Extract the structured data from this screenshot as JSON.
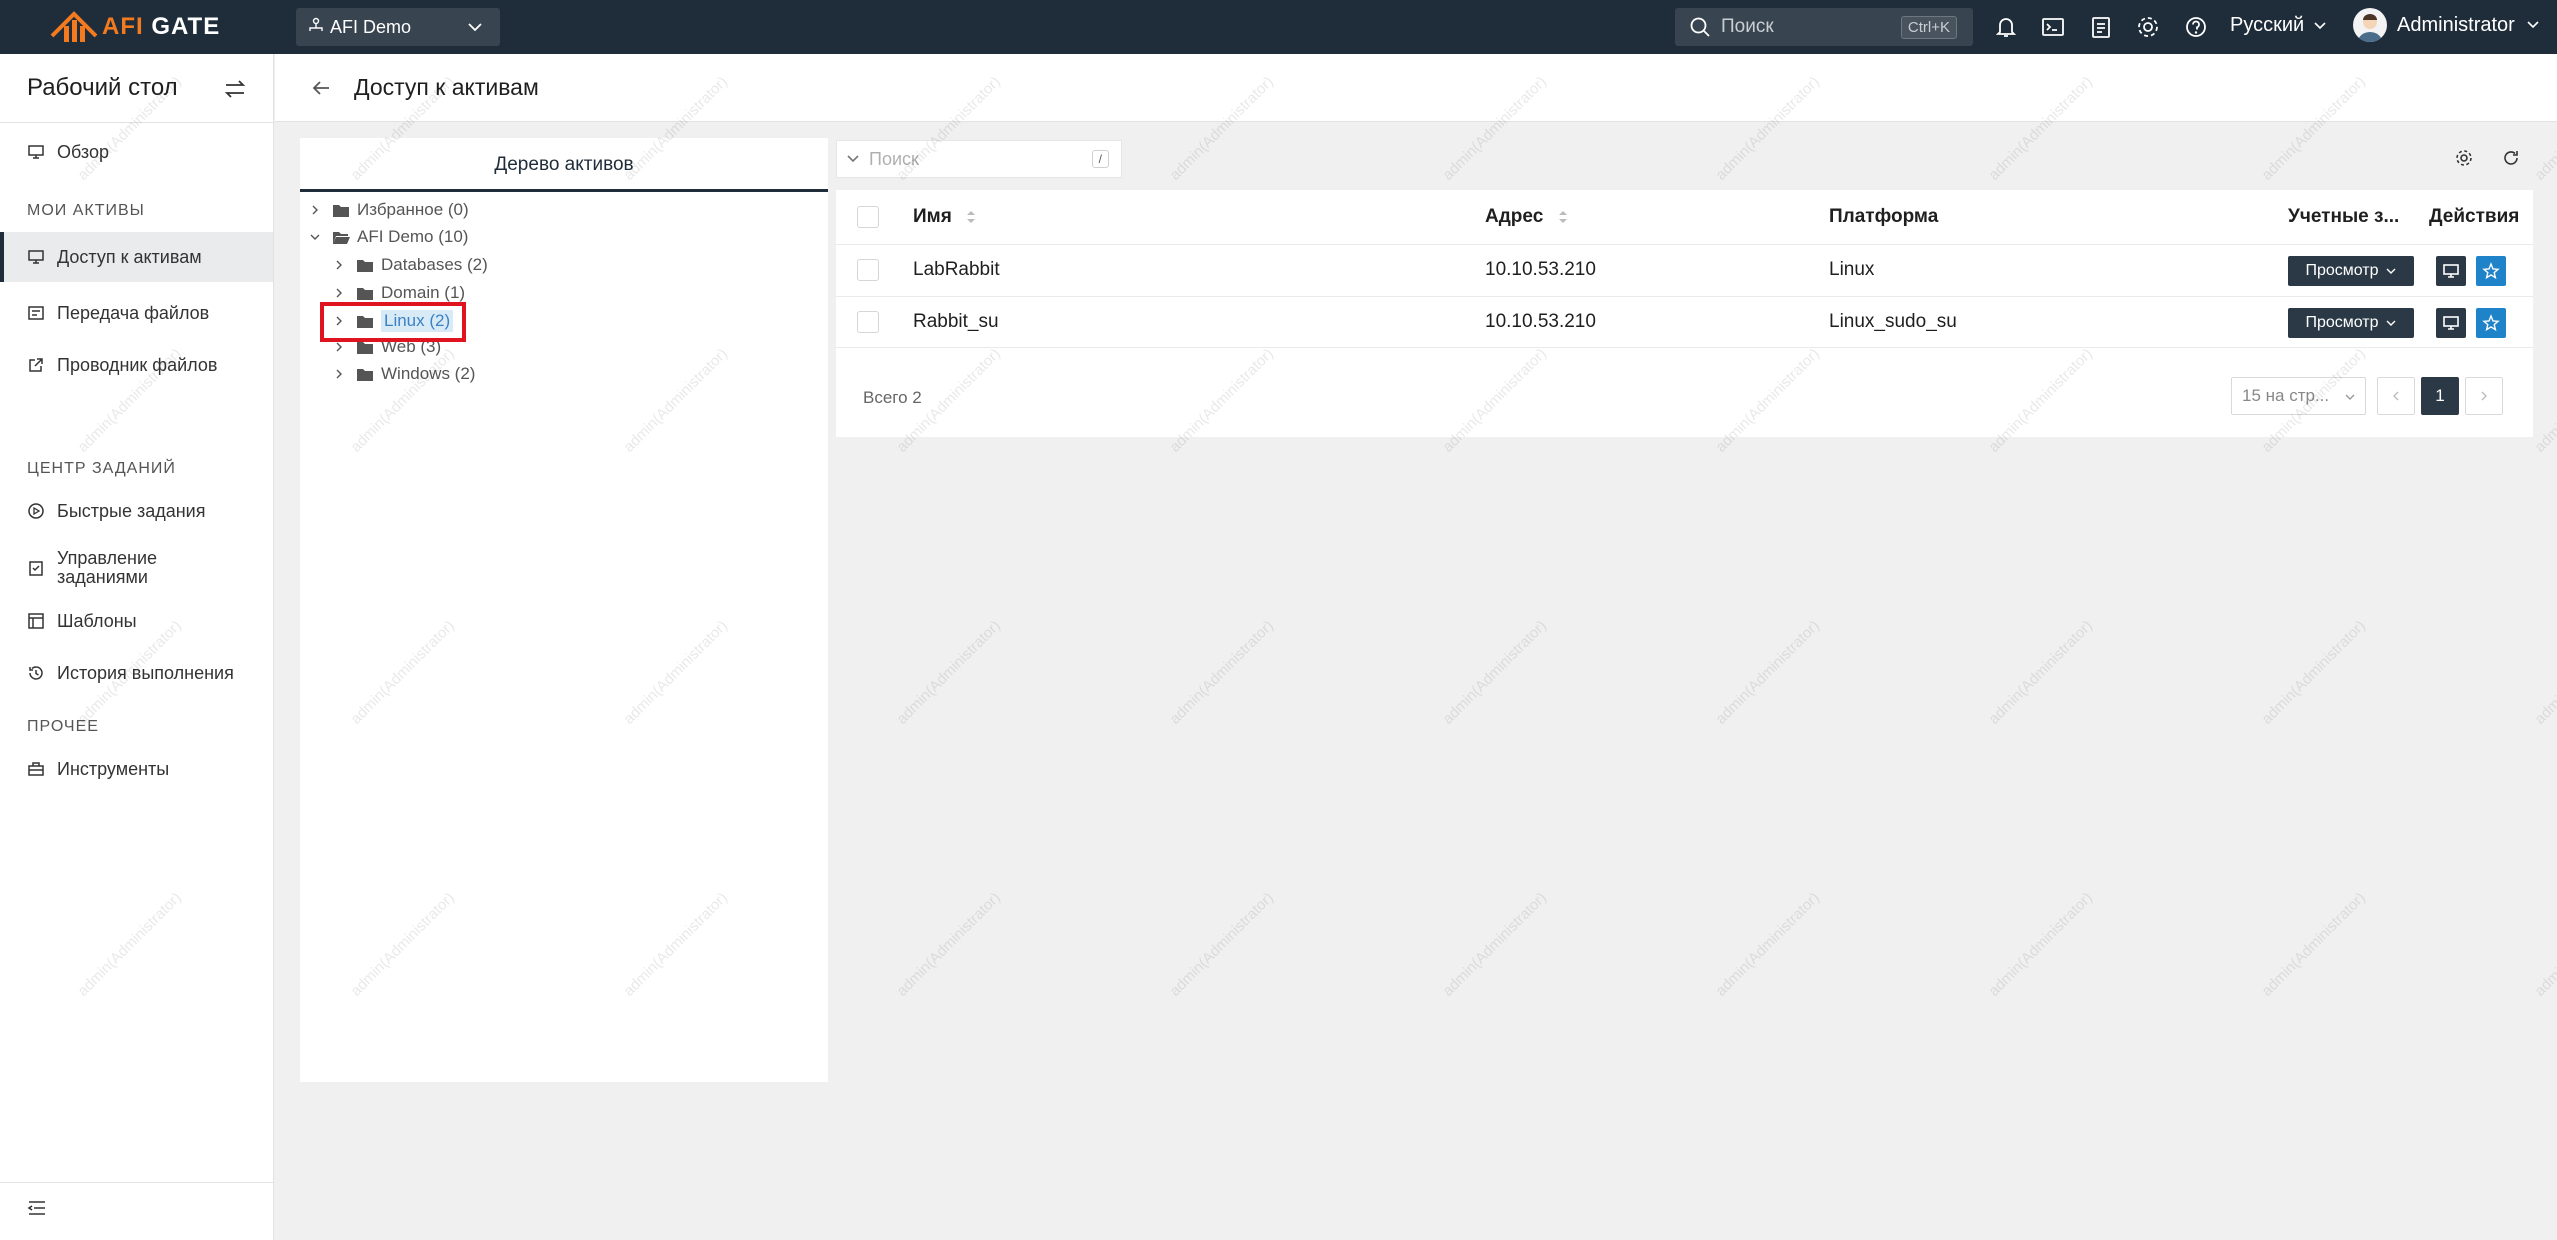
{
  "header": {
    "logo_text": "AFI GATE",
    "logo_text_accent": "AFI",
    "logo_text_rest": " GATE",
    "org": "AFI Demo",
    "search_placeholder": "Поиск",
    "search_shortcut": "Ctrl+K",
    "language": "Русский",
    "user": "Administrator"
  },
  "sidebar": {
    "title": "Рабочий стол",
    "overview": "Обзор",
    "group_my_assets": "МОИ АКТИВЫ",
    "asset_access": "Доступ к активам",
    "file_transfer": "Передача файлов",
    "file_explorer": "Проводник файлов",
    "group_tasks": "ЦЕНТР ЗАДАНИЙ",
    "quick_tasks": "Быстрые задания",
    "task_mgmt_1": "Управление",
    "task_mgmt_2": "заданиями",
    "templates": "Шаблоны",
    "history": "История выполнения",
    "group_other": "ПРОЧЕЕ",
    "tools": "Инструменты"
  },
  "page": {
    "title": "Доступ к активам"
  },
  "tree": {
    "tab": "Дерево активов",
    "nodes": [
      {
        "label": "Избранное (0)"
      },
      {
        "label": "AFI Demo (10)"
      },
      {
        "label": "Databases (2)"
      },
      {
        "label": "Domain (1)"
      },
      {
        "label": "Linux (2)"
      },
      {
        "label": "Web (3)"
      },
      {
        "label": "Windows (2)"
      }
    ]
  },
  "filter": {
    "placeholder": "Поиск",
    "shortcut": "/"
  },
  "table": {
    "columns": {
      "name": "Имя",
      "address": "Адрес",
      "platform": "Платформа",
      "accounts": "Учетные з...",
      "actions": "Действия"
    },
    "rows": [
      {
        "name": "LabRabbit",
        "address": "10.10.53.210",
        "platform": "Linux",
        "view": "Просмотр"
      },
      {
        "name": "Rabbit_su",
        "address": "10.10.53.210",
        "platform": "Linux_sudo_su",
        "view": "Просмотр"
      }
    ],
    "total": "Всего 2",
    "page_size": "15 на стр...",
    "current_page": "1"
  },
  "watermark": "admin(Administrator)",
  "colors": {
    "topbar": "#1f2d3a",
    "accent_orange": "#f47a20",
    "button_dark": "#2b3946",
    "button_blue": "#1f83c9",
    "highlight_red": "#e0141f"
  }
}
